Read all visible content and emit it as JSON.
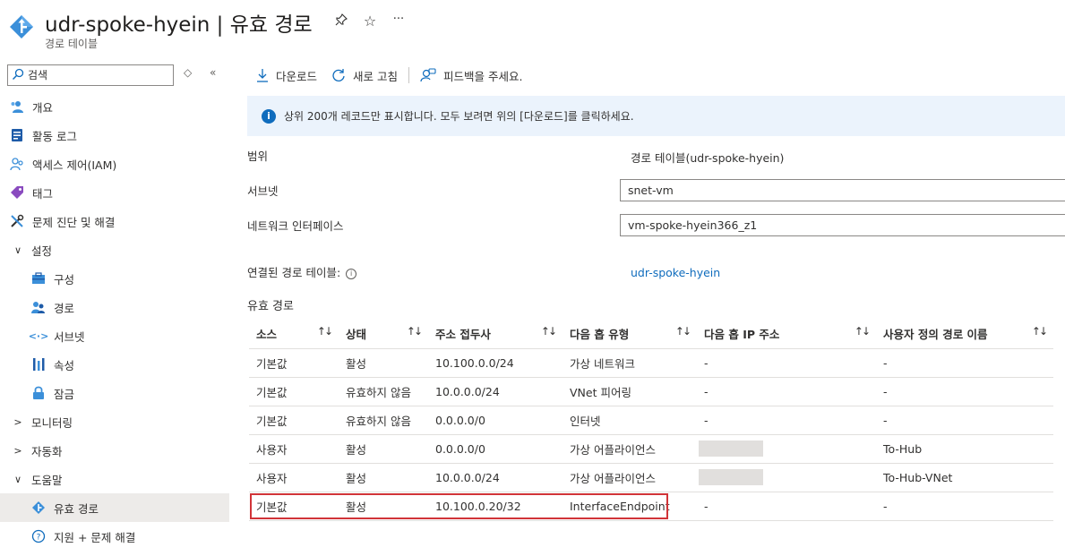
{
  "header": {
    "title": "udr-spoke-hyein | 유효 경로",
    "subtitle": "경로 테이블",
    "actions": [
      "pin-icon",
      "star-icon",
      "more-icon"
    ]
  },
  "sidebar": {
    "search_placeholder": "검색",
    "items": [
      {
        "label": "개요",
        "icon": "overview-icon"
      },
      {
        "label": "활동 로그",
        "icon": "activity-log-icon"
      },
      {
        "label": "액세스 제어(IAM)",
        "icon": "iam-icon"
      },
      {
        "label": "태그",
        "icon": "tag-icon"
      },
      {
        "label": "문제 진단 및 해결",
        "icon": "diagnose-icon"
      },
      {
        "label": "설정",
        "icon": "chevron-down-icon"
      },
      {
        "label": "구성",
        "icon": "configuration-icon"
      },
      {
        "label": "경로",
        "icon": "routes-icon"
      },
      {
        "label": "서브넷",
        "icon": "subnet-icon"
      },
      {
        "label": "속성",
        "icon": "properties-icon"
      },
      {
        "label": "잠금",
        "icon": "lock-icon"
      },
      {
        "label": "모니터링",
        "icon": "chevron-right-icon"
      },
      {
        "label": "자동화",
        "icon": "chevron-right-icon"
      },
      {
        "label": "도움말",
        "icon": "chevron-down-icon"
      },
      {
        "label": "유효 경로",
        "icon": "effective-routes-icon"
      },
      {
        "label": "지원 + 문제 해결",
        "icon": "help-icon"
      }
    ]
  },
  "toolbar": {
    "download": "다운로드",
    "refresh": "새로 고침",
    "feedback": "피드백을 주세요."
  },
  "info_bar": "상위 200개 레코드만 표시합니다. 모두 보려면 위의 [다운로드]를 클릭하세요.",
  "fields": {
    "scope_label": "범위",
    "scope_value": "경로 테이블(udr-spoke-hyein)",
    "subnet_label": "서브넷",
    "subnet_value": "snet-vm",
    "nic_label": "네트워크 인터페이스",
    "nic_value": "vm-spoke-hyein366_z1",
    "assoc_label": "연결된 경로 테이블:",
    "assoc_value": "udr-spoke-hyein"
  },
  "routes": {
    "title": "유효 경로",
    "columns": [
      "소스",
      "상태",
      "주소 접두사",
      "다음 홉 유형",
      "다음 홉 IP 주소",
      "사용자 정의 경로 이름"
    ],
    "rows": [
      [
        "기본값",
        "활성",
        "10.100.0.0/24",
        "가상 네트워크",
        "-",
        "-"
      ],
      [
        "기본값",
        "유효하지 않음",
        "10.0.0.0/24",
        "VNet 피어링",
        "-",
        "-"
      ],
      [
        "기본값",
        "유효하지 않음",
        "0.0.0.0/0",
        "인터넷",
        "-",
        "-"
      ],
      [
        "사용자",
        "활성",
        "0.0.0.0/0",
        "가상 어플라이언스",
        "",
        "To-Hub"
      ],
      [
        "사용자",
        "활성",
        "10.0.0.0/24",
        "가상 어플라이언스",
        "",
        "To-Hub-VNet"
      ],
      [
        "기본값",
        "활성",
        "10.100.0.20/32",
        "InterfaceEndpoint",
        "-",
        "-"
      ]
    ],
    "highlighted_row": 5,
    "highlight_color": "#d13438"
  }
}
